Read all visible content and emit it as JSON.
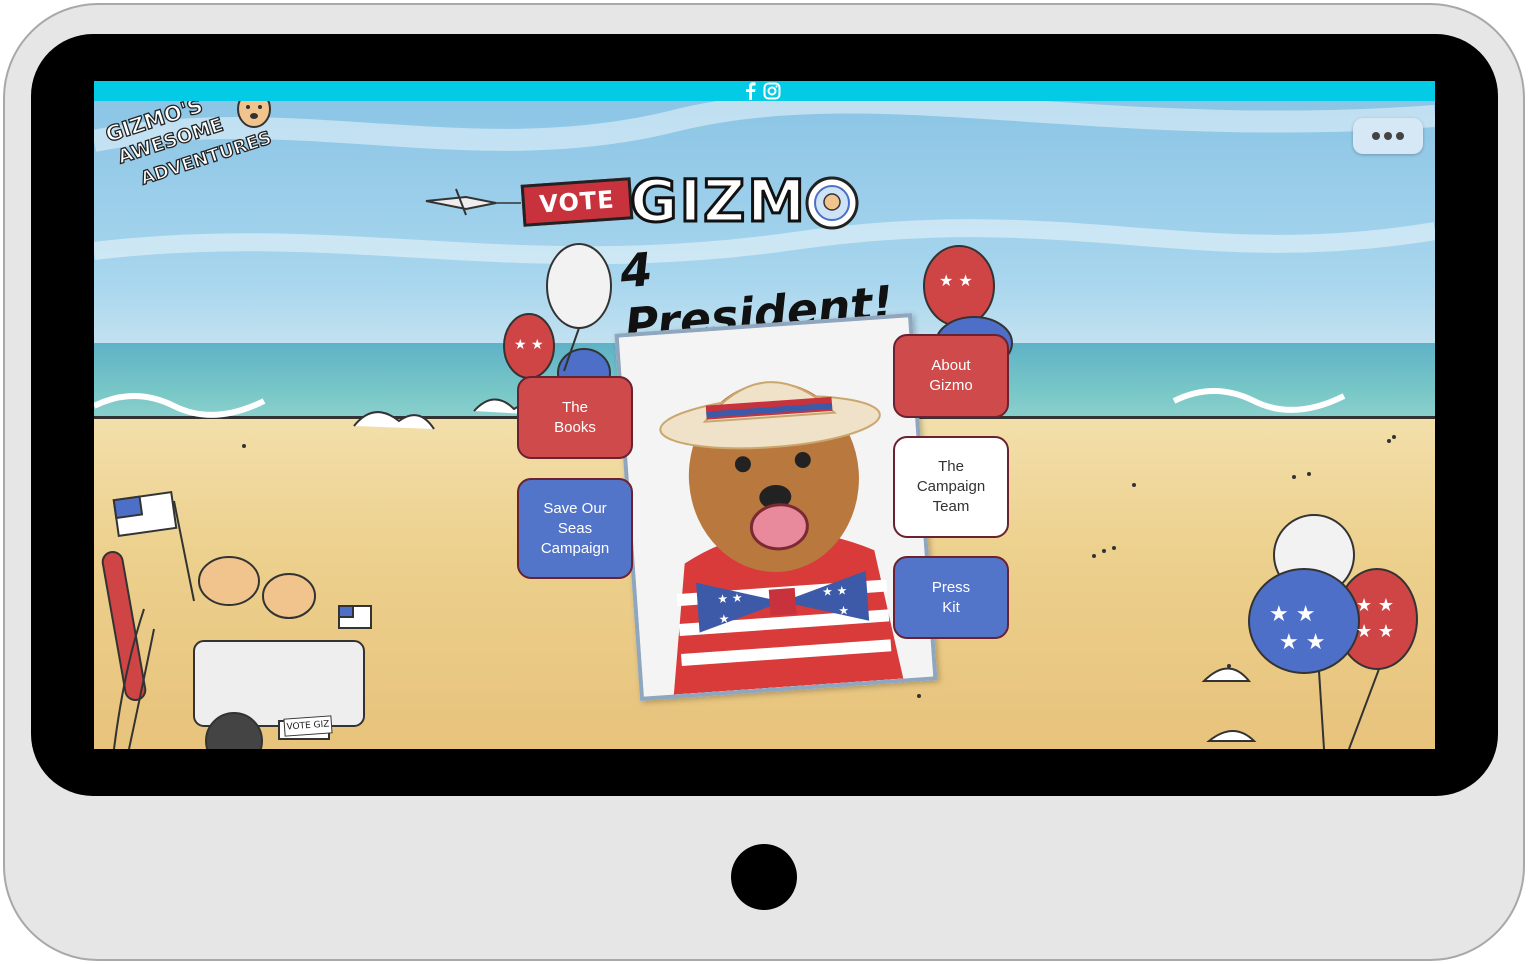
{
  "logo": {
    "line1": "GIZMO'S",
    "line2": "AWESOME",
    "line3": "ADVENTURES"
  },
  "headline": {
    "vote_badge": "VOTE",
    "name": "GIZMO",
    "subtitle": "4 President!"
  },
  "social_icons": [
    "facebook-icon",
    "instagram-icon"
  ],
  "nav_buttons": {
    "books": "The\nBooks",
    "save_seas": "Save Our\nSeas\nCampaign",
    "about": "About\nGizmo",
    "campaign_team": "The\nCampaign\nTeam",
    "press_kit": "Press\nKit"
  },
  "jeep_plate": "VOTE GIZ",
  "colors": {
    "social_bar": "#03cbe5",
    "button_red": "#cf4a4a",
    "button_blue": "#5275c9",
    "button_white": "#ffffff",
    "button_border": "#6a2130"
  }
}
